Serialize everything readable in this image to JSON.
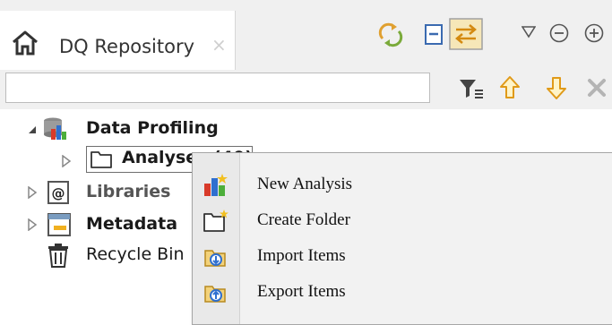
{
  "view": {
    "tab_title": "DQ Repository",
    "close_glyph": "×",
    "icons": [
      "home-icon",
      "sync-icon",
      "collapse-all-icon",
      "link-with-editor-icon",
      "view-menu-icon",
      "minimize-icon",
      "maximize-icon"
    ]
  },
  "filter": {
    "value": "",
    "placeholder": "",
    "icons": [
      "filter-icon",
      "move-up-icon",
      "move-down-icon",
      "clear-icon"
    ]
  },
  "tree": {
    "items": [
      {
        "label": "Data Profiling",
        "icon": "data-profiling-icon",
        "expanded": true
      },
      {
        "label": "Analyses (40)",
        "icon": "folder-icon",
        "expanded": false
      },
      {
        "label": "Libraries",
        "icon": "libraries-icon",
        "expanded": false
      },
      {
        "label": "Metadata",
        "icon": "metadata-icon",
        "expanded": false
      },
      {
        "label": "Recycle Bin",
        "icon": "recycle-bin-icon"
      }
    ]
  },
  "context_menu": {
    "items": [
      {
        "label": "New Analysis",
        "icon": "new-analysis-icon"
      },
      {
        "label": "Create Folder",
        "icon": "create-folder-icon"
      },
      {
        "label": "Import Items",
        "icon": "import-items-icon"
      },
      {
        "label": "Export Items",
        "icon": "export-items-icon"
      }
    ]
  },
  "colors": {
    "toolbar_bg": "#f0f0f0",
    "menu_bg": "#f2f2f2",
    "accent_orange": "#f0a020",
    "accent_blue": "#2f6fcf"
  }
}
